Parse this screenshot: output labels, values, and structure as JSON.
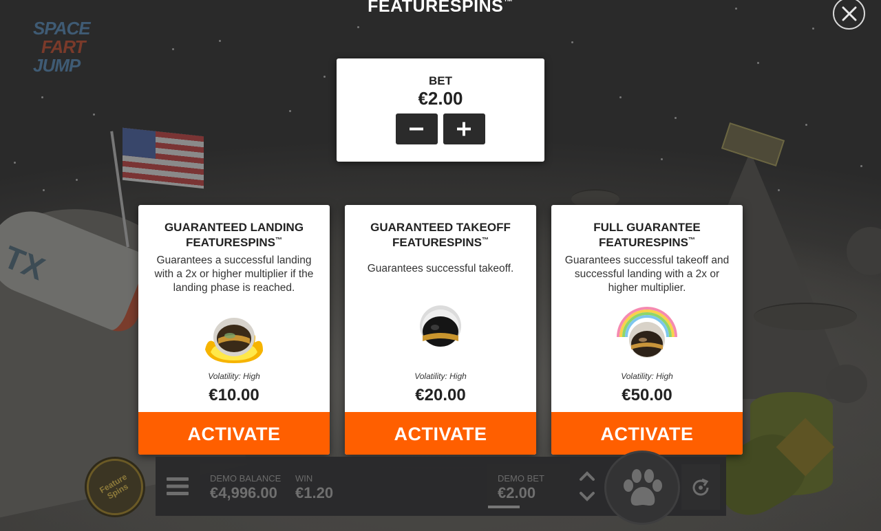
{
  "logo": {
    "line1": "SPACE",
    "line2": "FART",
    "line3": "JUMP"
  },
  "header": {
    "title": "FEATURESPINS",
    "trademark": "™",
    "close_icon": "close-icon"
  },
  "bet_panel": {
    "label": "BET",
    "value": "€2.00",
    "decrease_icon": "minus-icon",
    "increase_icon": "plus-icon"
  },
  "cards": [
    {
      "title_line1": "GUARANTEED LANDING",
      "title_line2": "FEATURESPINS",
      "trademark": "™",
      "description": "Guarantees a successful landing with a 2x or higher multiplier if the landing phase is reached.",
      "icon": "flaming-helmet-icon",
      "volatility": "Volatility: High",
      "price": "€10.00",
      "button": "ACTIVATE"
    },
    {
      "title_line1": "GUARANTEED TAKEOFF",
      "title_line2": "FEATURESPINS",
      "trademark": "™",
      "description": "Guarantees successful takeoff.",
      "icon": "helmet-icon",
      "volatility": "Volatility: High",
      "price": "€20.00",
      "button": "ACTIVATE"
    },
    {
      "title_line1": "FULL GUARANTEE",
      "title_line2": "FEATURESPINS",
      "trademark": "™",
      "description": "Guarantees successful takeoff and successful landing with a 2x or higher multiplier.",
      "icon": "rainbow-helmet-icon",
      "volatility": "Volatility: High",
      "price": "€50.00",
      "button": "ACTIVATE"
    }
  ],
  "bottom_bar": {
    "feature_spins_label": "Feature Spins",
    "menu_icon": "hamburger-menu-icon",
    "balance_label": "DEMO BALANCE",
    "balance_value": "€4,996.00",
    "win_label": "WIN",
    "win_value": "€1.20",
    "bet_label": "DEMO BET",
    "bet_value": "€2.00",
    "bet_up_icon": "chevron-up-icon",
    "bet_down_icon": "chevron-down-icon",
    "spin_icon": "paw-icon",
    "autoplay_icon": "autoplay-icon"
  },
  "colors": {
    "accent": "#ff5f00",
    "panel": "#ffffff",
    "dark_button": "#2b2b2b"
  }
}
